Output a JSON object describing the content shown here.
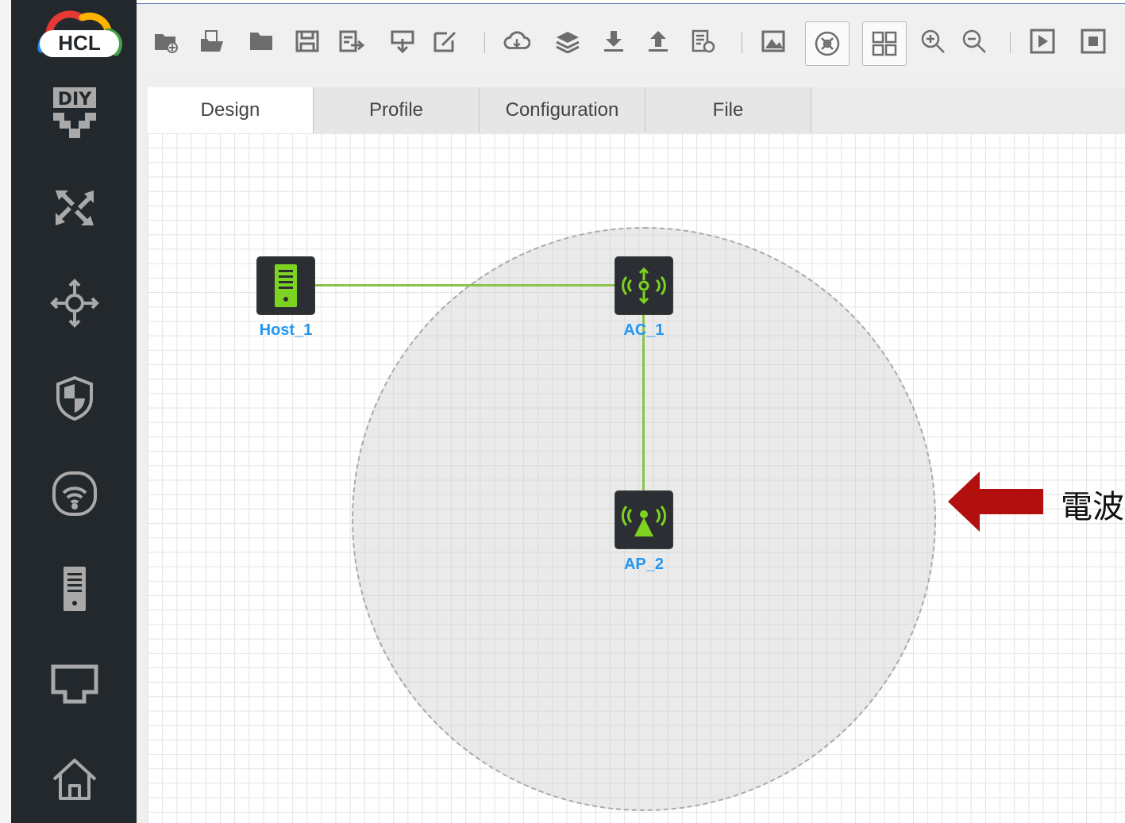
{
  "app": {
    "logo_text": "HCL"
  },
  "sidebar": {
    "items": [
      {
        "name": "diy",
        "icon": "diy-icon"
      },
      {
        "name": "switch",
        "icon": "switch-icon"
      },
      {
        "name": "router",
        "icon": "router-icon"
      },
      {
        "name": "firewall",
        "icon": "firewall-icon"
      },
      {
        "name": "wireless",
        "icon": "wireless-icon"
      },
      {
        "name": "server",
        "icon": "server-icon"
      },
      {
        "name": "cable",
        "icon": "cable-icon"
      },
      {
        "name": "home",
        "icon": "home-icon"
      }
    ]
  },
  "toolbar": {
    "buttons": [
      "new-project-icon",
      "open-project-icon",
      "open-folder-icon",
      "save-icon",
      "save-as-icon",
      "export-icon",
      "edit-icon",
      "cloud-icon",
      "layers-icon",
      "download-icon",
      "upload-icon",
      "log-icon",
      "capture-icon",
      "show-topology-icon",
      "grid-layout-icon",
      "zoom-in-icon",
      "zoom-out-icon",
      "start-icon",
      "stop-icon"
    ]
  },
  "tabs": [
    {
      "label": "Design",
      "active": true
    },
    {
      "label": "Profile",
      "active": false
    },
    {
      "label": "Configuration",
      "active": false
    },
    {
      "label": "File",
      "active": false
    }
  ],
  "topology": {
    "nodes": [
      {
        "label": "Host_1",
        "type": "host"
      },
      {
        "label": "AC_1",
        "type": "access-controller"
      },
      {
        "label": "AP_2",
        "type": "access-point"
      }
    ],
    "link_color": "#8bc34a"
  },
  "annotation": {
    "text": "電波",
    "arrow_color": "#b20f0f"
  },
  "colors": {
    "sidebar": "#23282d",
    "device_green": "#7ed321",
    "label_blue": "#2196f3"
  }
}
